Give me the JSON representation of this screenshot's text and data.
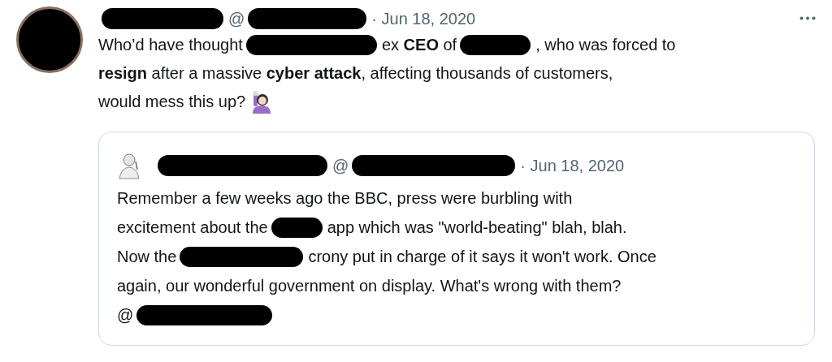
{
  "tweet": {
    "header": [
      {
        "kind": "redacted"
      },
      {
        "kind": "text",
        "text": "@"
      },
      {
        "kind": "redacted"
      },
      {
        "kind": "text",
        "text": "· Jun 18, 2020"
      }
    ],
    "lines": [
      [
        {
          "kind": "text",
          "text": "Who’d have thought"
        },
        {
          "kind": "redacted"
        },
        {
          "kind": "text",
          "text": "ex **CEO** of"
        },
        {
          "kind": "redacted"
        },
        {
          "kind": "text",
          "text": ", who was forced to"
        }
      ],
      [
        {
          "kind": "text",
          "text": "**resign** after a massive **cyber attack**, affecting thousands of customers,"
        }
      ],
      [
        {
          "kind": "text",
          "text": "would mess this up?"
        },
        {
          "kind": "emoji"
        }
      ]
    ],
    "quote": {
      "header": [
        {
          "kind": "redacted"
        },
        {
          "kind": "text",
          "text": "@"
        },
        {
          "kind": "redacted"
        },
        {
          "kind": "text",
          "text": "· Jun 18, 2020"
        }
      ],
      "lines": [
        [
          {
            "kind": "text",
            "text": "Remember a few weeks ago the BBC, press were burbling with"
          }
        ],
        [
          {
            "kind": "text",
            "text": "excitement about the"
          },
          {
            "kind": "redacted"
          },
          {
            "kind": "text",
            "text": "app which was \"world-beating\" blah, blah."
          }
        ],
        [
          {
            "kind": "text",
            "text": "Now the"
          },
          {
            "kind": "redacted"
          },
          {
            "kind": "text",
            "text": "crony put in charge of it says it won't work. Once"
          }
        ],
        [
          {
            "kind": "text",
            "text": "again, our wonderful government on display. What's wrong with them?"
          }
        ],
        [
          {
            "kind": "text",
            "text": "@"
          },
          {
            "kind": "redacted"
          }
        ]
      ]
    }
  }
}
